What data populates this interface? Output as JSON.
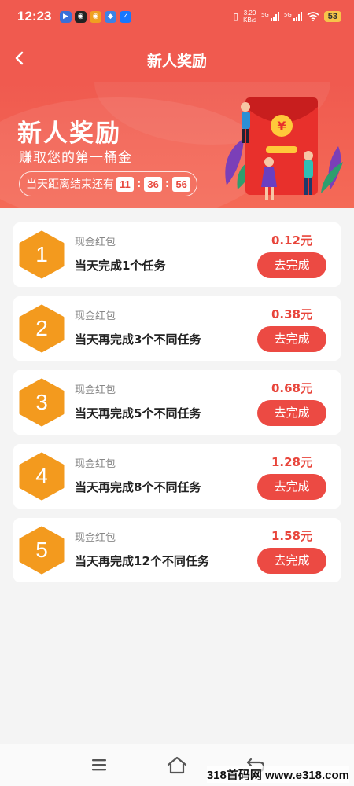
{
  "status_bar": {
    "time": "12:23",
    "net_speed_value": "3.20",
    "net_speed_unit": "KB/s",
    "signal_label_1": "5G",
    "signal_label_2": "5G",
    "battery": "53"
  },
  "header": {
    "title": "新人奖励"
  },
  "banner": {
    "title": "新人奖励",
    "subtitle": "赚取您的第一桶金",
    "countdown_label": "当天距离结束还有",
    "hours": "11",
    "minutes": "36",
    "seconds": "56"
  },
  "tasks": [
    {
      "number": "1",
      "type": "现金红包",
      "desc": "当天完成1个任务",
      "reward": "0.12元",
      "button": "去完成"
    },
    {
      "number": "2",
      "type": "现金红包",
      "desc": "当天再完成3个不同任务",
      "reward": "0.38元",
      "button": "去完成"
    },
    {
      "number": "3",
      "type": "现金红包",
      "desc": "当天再完成5个不同任务",
      "reward": "0.68元",
      "button": "去完成"
    },
    {
      "number": "4",
      "type": "现金红包",
      "desc": "当天再完成8个不同任务",
      "reward": "1.28元",
      "button": "去完成"
    },
    {
      "number": "5",
      "type": "现金红包",
      "desc": "当天再完成12个不同任务",
      "reward": "1.58元",
      "button": "去完成"
    }
  ],
  "watermark": "318首码网 www.e318.com",
  "colors": {
    "brand_red": "#f05a4f",
    "button_red": "#ec4a43",
    "reward_red": "#e8453b",
    "hex_orange": "#f39a1e"
  },
  "icons": [
    "back-arrow-icon",
    "menu-icon",
    "home-icon",
    "return-icon",
    "red-envelope-icon",
    "yuan-coin-icon"
  ]
}
